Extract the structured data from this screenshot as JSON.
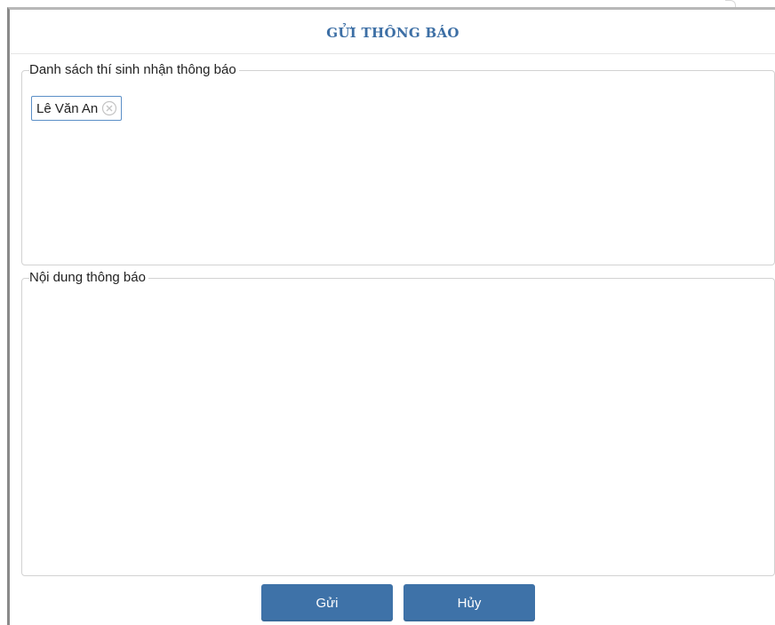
{
  "dialog": {
    "title": "GỬI THÔNG BÁO"
  },
  "recipients_panel": {
    "legend": "Danh sách thí sinh nhận thông báo",
    "recipients": [
      {
        "name": "Lê Văn An"
      }
    ]
  },
  "content_panel": {
    "legend": "Nội dung thông báo",
    "value": ""
  },
  "buttons": {
    "send_label": "Gửi",
    "cancel_label": "Hủy"
  },
  "colors": {
    "accent": "#3e72a8",
    "title": "#3d6fa5",
    "tag_border": "#5b8fc7"
  },
  "icons": {
    "recipient_remove": "close-circle-icon"
  }
}
